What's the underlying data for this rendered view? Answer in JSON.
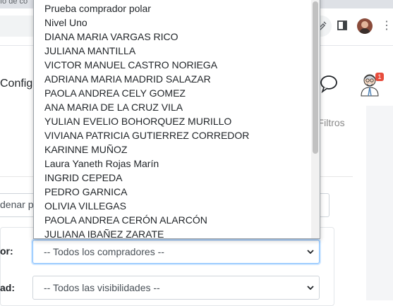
{
  "browser": {
    "tab_text": "ío de co"
  },
  "header": {
    "config_label": "Configu",
    "notification_count": "1"
  },
  "filters": {
    "filtros_label": "r Filtros",
    "ordenar_label": "denar p",
    "comprador_label": "or:",
    "visibilidad_label": "ad:",
    "comprador_value": "-- Todos los compradores --",
    "visibilidad_value": "-- Todos las visibilidades --"
  },
  "dropdown": {
    "options": [
      "Prueba comprador polar",
      "Nivel Uno",
      "DIANA MARIA VARGAS RICO",
      "JULIANA MANTILLA",
      "VICTOR MANUEL CASTRO NORIEGA",
      "ADRIANA MARIA MADRID SALAZAR",
      "PAOLA ANDREA CELY GOMEZ",
      "ANA MARIA DE LA CRUZ VILA",
      "YULIAN EVELIO BOHORQUEZ MURILLO",
      "VIVIANA PATRICIA GUTIERREZ CORREDOR",
      "KARINNE MUÑOZ",
      "Laura Yaneth Rojas Marín",
      "INGRID CEPEDA",
      "PEDRO GARNICA",
      "OLIVIA VILLEGAS",
      "PAOLA ANDREA CERÓN ALARCÓN",
      "JULIANA IBAÑEZ ZARATE"
    ]
  }
}
